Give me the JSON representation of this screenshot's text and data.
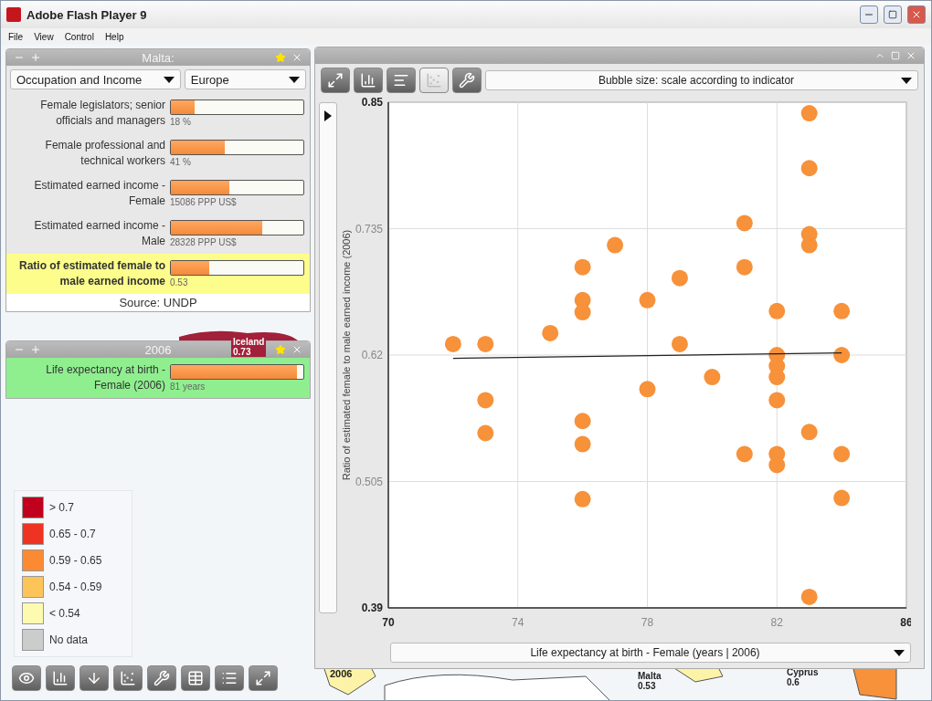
{
  "window": {
    "title": "Adobe Flash Player 9"
  },
  "menu": [
    "File",
    "View",
    "Control",
    "Help"
  ],
  "profile_panel": {
    "title": "Malta:",
    "kind": "y-axis",
    "starred": true,
    "dropdowns": [
      "Occupation and Income",
      "Europe"
    ],
    "indicators": [
      {
        "label": "Female legislators; senior officials and managers",
        "value": "18 %",
        "level": 0.18,
        "highlighted": false
      },
      {
        "label": "Female professional and technical workers",
        "value": "41 %",
        "level": 0.41,
        "highlighted": false
      },
      {
        "label": "Estimated earned income - Female",
        "value": "15086  PPP US$",
        "level": 0.44,
        "highlighted": false
      },
      {
        "label": "Estimated earned income - Male",
        "value": "28328  PPP US$",
        "level": 0.69,
        "highlighted": false
      },
      {
        "label": "Ratio of estimated female to male earned income",
        "value": "0.53",
        "level": 0.29,
        "highlighted": true
      }
    ],
    "source": "Source: UNDP"
  },
  "year_panel": {
    "title": "2006",
    "kind": "x-axis",
    "starred": true,
    "indicators": [
      {
        "label": "Life expectancy at birth - Female (2006)",
        "value": "81 years",
        "level": 0.95,
        "highlighted": true
      }
    ]
  },
  "legend": [
    {
      "label": "> 0.7",
      "color": "#c0001c"
    },
    {
      "label": "0.65 - 0.7",
      "color": "#ee3322"
    },
    {
      "label": "0.59 - 0.65",
      "color": "#fb8a33"
    },
    {
      "label": "0.54 - 0.59",
      "color": "#fdc45a"
    },
    {
      "label": "< 0.54",
      "color": "#fefbb0"
    },
    {
      "label": "No data",
      "color": "#cccccc"
    }
  ],
  "bottom_toolbar": [
    {
      "kind": "eye"
    },
    {
      "kind": "bars"
    },
    {
      "kind": "download"
    },
    {
      "kind": "scatter"
    },
    {
      "kind": "wrench"
    },
    {
      "kind": "table"
    },
    {
      "kind": "list"
    },
    {
      "kind": "expand"
    }
  ],
  "map": {
    "year": "2006",
    "labels": [
      {
        "name": "Iceland",
        "value": "0.73"
      },
      {
        "name": "Malta",
        "value": "0.53"
      },
      {
        "name": "Cyprus",
        "value": "0.6"
      }
    ]
  },
  "chart_panel": {
    "tools": [
      {
        "kind": "expand",
        "selected": false
      },
      {
        "kind": "bars",
        "selected": false
      },
      {
        "kind": "hbars",
        "selected": false
      },
      {
        "kind": "scatter",
        "selected": true
      },
      {
        "kind": "wrench",
        "selected": false
      }
    ],
    "bubble_dropdown": "Bubble size: scale according to indicator",
    "chart_data": {
      "type": "scatter",
      "xlabel": "Life expectancy at birth - Female  (years | 2006)",
      "ylabel": "Ratio of estimated female to male earned income (2006)",
      "grid": true,
      "xlim": [
        70,
        86
      ],
      "ylim": [
        0.39,
        0.85
      ],
      "xticks": [
        70,
        74,
        78,
        82,
        86
      ],
      "yticks": [
        {
          "value": 0.85,
          "label": "0.85"
        },
        {
          "value": 0.735,
          "label": "0.735"
        },
        {
          "value": 0.62,
          "label": "0.62"
        },
        {
          "value": 0.505,
          "label": "0.505"
        },
        {
          "value": 0.39,
          "label": "0.39"
        }
      ],
      "series": [
        {
          "color": "#f7913a",
          "x": [
            72,
            73,
            73,
            73,
            75,
            76,
            76,
            76,
            76,
            76,
            76,
            77,
            78,
            78,
            79,
            79,
            80,
            81,
            81,
            81,
            82,
            82,
            82,
            82,
            82,
            82,
            82,
            83,
            83,
            83,
            83,
            83,
            83,
            84,
            84,
            84,
            84
          ],
          "values": [
            0.63,
            0.63,
            0.579,
            0.549,
            0.64,
            0.7,
            0.67,
            0.659,
            0.56,
            0.539,
            0.489,
            0.72,
            0.67,
            0.589,
            0.69,
            0.63,
            0.6,
            0.74,
            0.7,
            0.53,
            0.66,
            0.62,
            0.61,
            0.6,
            0.579,
            0.53,
            0.52,
            0.84,
            0.79,
            0.73,
            0.72,
            0.55,
            0.4,
            0.66,
            0.62,
            0.53,
            0.49
          ]
        },
        {
          "type": "line",
          "color": "#222222",
          "x": [
            72,
            84
          ],
          "values": [
            0.617,
            0.622
          ]
        }
      ]
    }
  }
}
